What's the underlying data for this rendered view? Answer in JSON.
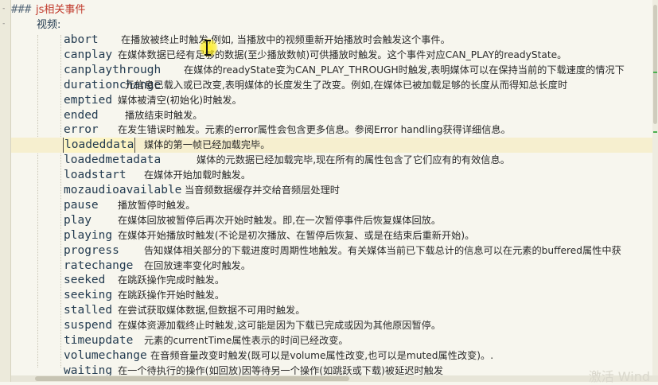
{
  "header": {
    "hashes": "###",
    "title": "js相关事件"
  },
  "section": {
    "title": "视频:"
  },
  "events": [
    {
      "name": "abort",
      "desc": "在播放被终止时触发,例如, 当播放中的视频重新开始播放时会触发这个事件。"
    },
    {
      "name": "canplay",
      "desc": "在媒体数据已经有足够的数据(至少播放数帧)可供播放时触发。这个事件对应CAN_PLAY的readyState。"
    },
    {
      "name": "canplaythrough",
      "desc": "在媒体的readyState变为CAN_PLAY_THROUGH时触发,表明媒体可以在保持当前的下载速度的情况下"
    },
    {
      "name": "durationchange",
      "desc": "元信息已载入或已改变,表明媒体的长度发生了改变。例如,在媒体已被加载足够的长度从而得知总长度时"
    },
    {
      "name": "emptied",
      "desc": "媒体被清空(初始化)时触发。"
    },
    {
      "name": "ended",
      "desc": "播放结束时触发。"
    },
    {
      "name": "error",
      "desc": "在发生错误时触发。元素的error属性会包含更多信息。参阅Error handling获得详细信息。"
    },
    {
      "name": "loadeddata",
      "desc": "媒体的第一帧已经加载完毕。"
    },
    {
      "name": "loadedmetadata",
      "desc": "媒体的元数据已经加载完毕,现在所有的属性包含了它们应有的有效信息。"
    },
    {
      "name": "loadstart",
      "desc": "在媒体开始加载时触发。"
    },
    {
      "name": "mozaudioavailable",
      "desc": "当音频数据缓存并交给音频层处理时"
    },
    {
      "name": "pause",
      "desc": "播放暂停时触发。"
    },
    {
      "name": "play",
      "desc": "在媒体回放被暂停后再次开始时触发。即,在一次暂停事件后恢复媒体回放。"
    },
    {
      "name": "playing",
      "desc": "在媒体开始播放时触发(不论是初次播放、在暂停后恢复、或是在结束后重新开始)。"
    },
    {
      "name": "progress",
      "desc": "告知媒体相关部分的下载进度时周期性地触发。有关媒体当前已下载总计的信息可以在元素的buffered属性中获"
    },
    {
      "name": "ratechange",
      "desc": "在回放速率变化时触发。"
    },
    {
      "name": "seeked",
      "desc": "在跳跃操作完成时触发。"
    },
    {
      "name": "seeking",
      "desc": "在跳跃操作开始时触发。"
    },
    {
      "name": "stalled",
      "desc": "在尝试获取媒体数据,但数据不可用时触发。"
    },
    {
      "name": "suspend",
      "desc": "在媒体资源加载终止时触发,这可能是因为下载已完成或因为其他原因暂停。"
    },
    {
      "name": "timeupdate",
      "desc": "元素的currentTime属性表示的时间已经改变。"
    },
    {
      "name": "volumechange",
      "desc": "在音频音量改变时触发(既可以是volume属性改变,也可以是muted属性改变)。."
    },
    {
      "name": "waiting",
      "desc": "在一个待执行的操作(如回放)因等待另一个操作(如跳跃或下载)被延迟时触发"
    }
  ],
  "selected_event_index": 7,
  "watermark": "激活 Wind",
  "colors": {
    "background": "#f7f6ee",
    "title": "#c0392b",
    "event_name": "#233b50",
    "current_line": "#f6efcf",
    "cursor_highlight": "#ffec00"
  }
}
